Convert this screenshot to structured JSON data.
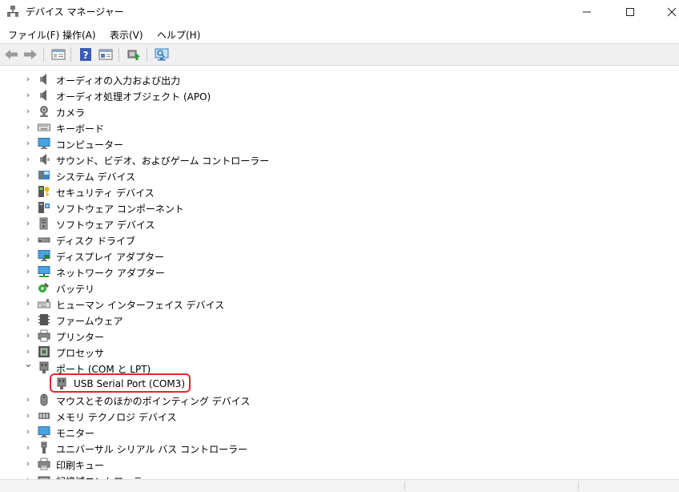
{
  "window": {
    "title": "デバイス マネージャー"
  },
  "menu": [
    "ファイル(F)",
    "操作(A)",
    "表示(V)",
    "ヘルプ(H)"
  ],
  "toolbar_icons": [
    "back-icon",
    "forward-icon",
    "properties-pane-icon",
    "help-icon",
    "console-tree-icon",
    "update-driver-icon",
    "monitor-scan-icon"
  ],
  "tree": {
    "items": [
      {
        "label": "オーディオの入力および出力",
        "icon": "speaker-icon",
        "state": "collapsed"
      },
      {
        "label": "オーディオ処理オブジェクト (APO)",
        "icon": "speaker-icon",
        "state": "collapsed"
      },
      {
        "label": "カメラ",
        "icon": "camera-icon",
        "state": "collapsed"
      },
      {
        "label": "キーボード",
        "icon": "keyboard-icon",
        "state": "collapsed"
      },
      {
        "label": "コンピューター",
        "icon": "computer-icon",
        "state": "collapsed"
      },
      {
        "label": "サウンド、ビデオ、およびゲーム コントローラー",
        "icon": "sound-icon",
        "state": "collapsed"
      },
      {
        "label": "システム デバイス",
        "icon": "system-device-icon",
        "state": "collapsed"
      },
      {
        "label": "セキュリティ デバイス",
        "icon": "security-device-icon",
        "state": "collapsed"
      },
      {
        "label": "ソフトウェア コンポーネント",
        "icon": "software-component-icon",
        "state": "collapsed"
      },
      {
        "label": "ソフトウェア デバイス",
        "icon": "software-device-icon",
        "state": "collapsed"
      },
      {
        "label": "ディスク ドライブ",
        "icon": "disk-drive-icon",
        "state": "collapsed"
      },
      {
        "label": "ディスプレイ アダプター",
        "icon": "display-adapter-icon",
        "state": "collapsed"
      },
      {
        "label": "ネットワーク アダプター",
        "icon": "network-adapter-icon",
        "state": "collapsed"
      },
      {
        "label": "バッテリ",
        "icon": "battery-icon",
        "state": "collapsed"
      },
      {
        "label": "ヒューマン インターフェイス デバイス",
        "icon": "hid-icon",
        "state": "collapsed"
      },
      {
        "label": "ファームウェア",
        "icon": "firmware-icon",
        "state": "collapsed"
      },
      {
        "label": "プリンター",
        "icon": "printer-icon",
        "state": "collapsed"
      },
      {
        "label": "プロセッサ",
        "icon": "processor-icon",
        "state": "collapsed"
      },
      {
        "label": "ポート (COM と LPT)",
        "icon": "port-icon",
        "state": "expanded"
      },
      {
        "label": "USB Serial Port (COM3)",
        "icon": "port-icon",
        "state": "child"
      },
      {
        "label": "マウスとそのほかのポインティング デバイス",
        "icon": "mouse-icon",
        "state": "collapsed"
      },
      {
        "label": "メモリ テクノロジ デバイス",
        "icon": "memory-icon",
        "state": "collapsed"
      },
      {
        "label": "モニター",
        "icon": "monitor-icon",
        "state": "collapsed"
      },
      {
        "label": "ユニバーサル シリアル バス コントローラー",
        "icon": "usb-icon",
        "state": "collapsed"
      },
      {
        "label": "印刷キュー",
        "icon": "print-queue-icon",
        "state": "collapsed"
      },
      {
        "label": "記憶域コントローラー",
        "icon": "storage-controller-icon",
        "state": "collapsed"
      }
    ]
  },
  "colors": {
    "highlight_border": "#e0282e",
    "toolbar_bg": "#f0f0f0"
  }
}
